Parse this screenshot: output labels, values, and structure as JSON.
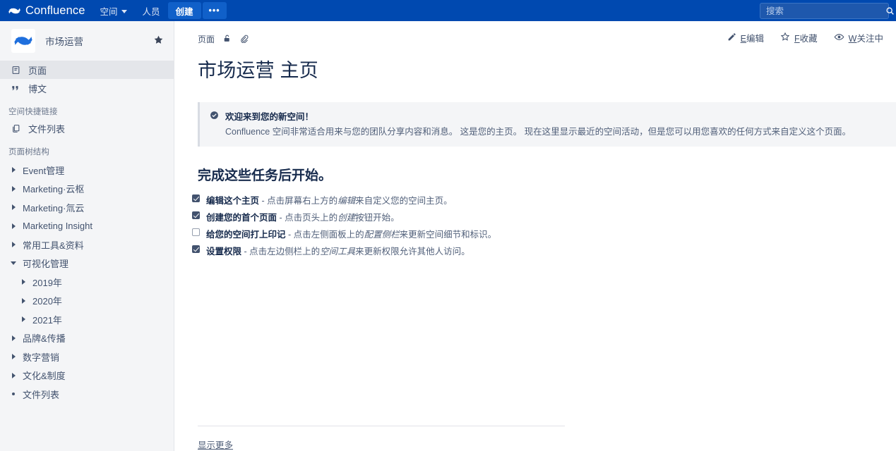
{
  "topbar": {
    "brand": "Confluence",
    "brand_logo_icon": "confluence-logo-icon",
    "nav": [
      {
        "label": "空间",
        "icon": "chevron-down-icon",
        "has_caret": true
      },
      {
        "label": "人员",
        "icon": "",
        "has_caret": false
      }
    ],
    "create_label": "创建",
    "more_label": "•••",
    "search": {
      "placeholder": "搜索",
      "value": "",
      "icon": "search-icon"
    },
    "background_color": "#0049b0",
    "accent_color": "#1060c9"
  },
  "sidebar": {
    "space_name": "市场运营",
    "space_avatar_icon": "confluence-space-avatar-icon",
    "star_icon": "star-filled-icon",
    "nav_items": [
      {
        "label": "页面",
        "icon": "page-icon",
        "active": true
      },
      {
        "label": "博文",
        "icon": "quote-icon",
        "active": false
      }
    ],
    "shortcut_section": {
      "title": "空间快捷链接",
      "items": [
        {
          "label": "文件列表",
          "icon": "copy-icon"
        }
      ]
    },
    "tree_section": {
      "title": "页面树结构",
      "items": [
        {
          "label": "Event管理",
          "level": 1,
          "marker": "chevron-right-icon"
        },
        {
          "label": "Marketing·云枢",
          "level": 1,
          "marker": "chevron-right-icon"
        },
        {
          "label": "Marketing·氚云",
          "level": 1,
          "marker": "chevron-right-icon"
        },
        {
          "label": "Marketing Insight",
          "level": 1,
          "marker": "chevron-right-icon"
        },
        {
          "label": "常用工具&资料",
          "level": 1,
          "marker": "chevron-right-icon"
        },
        {
          "label": "可视化管理",
          "level": 1,
          "marker": "chevron-down-icon"
        },
        {
          "label": "2019年",
          "level": 2,
          "marker": "chevron-right-icon"
        },
        {
          "label": "2020年",
          "level": 2,
          "marker": "chevron-right-icon"
        },
        {
          "label": "2021年",
          "level": 2,
          "marker": "chevron-right-icon"
        },
        {
          "label": "品牌&传播",
          "level": 1,
          "marker": "chevron-right-icon"
        },
        {
          "label": "数字营销",
          "level": 1,
          "marker": "chevron-right-icon"
        },
        {
          "label": "文化&制度",
          "level": 1,
          "marker": "chevron-right-icon"
        },
        {
          "label": "文件列表",
          "level": 1,
          "marker": "dot-icon"
        }
      ]
    },
    "resize_handle_name": "sidebar-resize-handle"
  },
  "main": {
    "breadcrumb": {
      "items": [
        {
          "label": "页面"
        }
      ],
      "restrictions_icon": "unlock-icon",
      "attachments_icon": "paperclip-icon"
    },
    "page_title": "市场运营 主页",
    "actions": [
      {
        "shortcut": "E",
        "label": "编辑",
        "icon": "pencil-icon"
      },
      {
        "shortcut": "F",
        "label": "收藏",
        "icon": "star-outline-icon"
      },
      {
        "shortcut": "W",
        "label": "关注中",
        "icon": "eye-icon"
      }
    ],
    "banner": {
      "icon": "check-circle-icon",
      "title": "欢迎来到您的新空间！",
      "body": "Confluence 空间非常适合用来与您的团队分享内容和消息。 这是您的主页。 现在这里显示最近的空间活动，但是您可以用您喜欢的任何方式来自定义这个页面。"
    },
    "tasks_heading": "完成这些任务后开始。",
    "tasks": [
      {
        "checked": true,
        "strong": "编辑这个主页",
        "pre": " - 点击屏幕右上方的",
        "em": "编辑",
        "post": "来自定义您的空间主页。"
      },
      {
        "checked": true,
        "strong": "创建您的首个页面",
        "pre": " - 点击页头上的",
        "em": "创建",
        "post": "按钮开始。"
      },
      {
        "checked": false,
        "strong": "给您的空间打上印记",
        "pre": " - 点击左侧面板上的",
        "em": "配置侧栏",
        "post": "来更新空间细节和标识。"
      },
      {
        "checked": true,
        "strong": "设置权限",
        "pre": " - 点击左边侧栏上的",
        "em": "空间工具",
        "post": "来更新权限允许其他人访问。"
      }
    ],
    "show_more_label": "显示更多"
  }
}
